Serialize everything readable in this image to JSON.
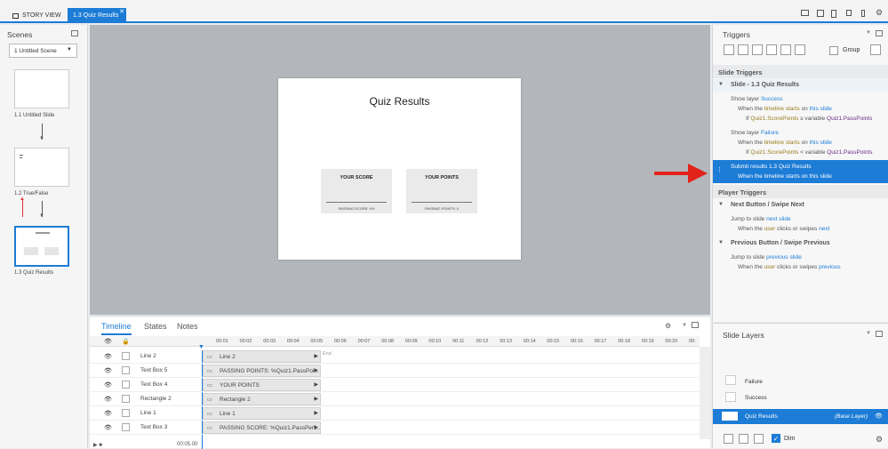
{
  "tabs": {
    "story_view": "STORY VIEW",
    "quiz_results": "1.3 Quiz Results"
  },
  "scenes": {
    "title": "Scenes",
    "dropdown": "1 Untitled Scene",
    "slides": [
      {
        "label": "1.1 Untitled Slide"
      },
      {
        "label": "1.2 True/False"
      },
      {
        "label": "1.3 Quiz Results"
      }
    ]
  },
  "slide": {
    "title": "Quiz Results",
    "score_label": "YOUR SCORE",
    "points_label": "YOUR POINTS",
    "passing_score": "PASSING SCORE: 0%",
    "passing_points": "PASSING POINTS: 0"
  },
  "timeline": {
    "tabs": [
      "Timeline",
      "States",
      "Notes"
    ],
    "ticks": [
      "00:01",
      "00:02",
      "00:03",
      "00:04",
      "00:05",
      "00:06",
      "00:07",
      "00:08",
      "00:09",
      "00:10",
      "00:11",
      "00:12",
      "00:13",
      "00:14",
      "00:15",
      "00:16",
      "00:17",
      "00:18",
      "00:19",
      "00:20",
      "00:"
    ],
    "end_label": "End",
    "time_readout": "00:05.00",
    "rows": [
      {
        "name": "Line 2",
        "bar": "Line 2"
      },
      {
        "name": "Text Box 5",
        "bar": "PASSING POINTS: %Quiz1.PassPoi..."
      },
      {
        "name": "Text Box 4",
        "bar": "YOUR POINTS"
      },
      {
        "name": "Rectangle 2",
        "bar": "Rectangle 2"
      },
      {
        "name": "Line 1",
        "bar": "Line 1"
      },
      {
        "name": "Text Box 3",
        "bar": "PASSING SCORE: %Quiz1.PassPerc..."
      }
    ]
  },
  "triggers": {
    "title": "Triggers",
    "group_label": "Group",
    "slide_triggers": "Slide Triggers",
    "slide_name": "Slide - 1.3 Quiz Results",
    "t1": {
      "l1a": "Show layer ",
      "l1b": "Success",
      "l2a": "When the ",
      "l2b": "timeline starts",
      "l2c": " on ",
      "l2d": "this slide",
      "l3a": "If ",
      "l3b": "Quiz1.ScorePoints",
      "l3c": " ≥ variable ",
      "l3d": "Quiz1.PassPoints"
    },
    "t2": {
      "l1a": "Show layer ",
      "l1b": "Failure",
      "l2a": "When the ",
      "l2b": "timeline starts",
      "l2c": " on ",
      "l2d": "this slide",
      "l3a": "If ",
      "l3b": "Quiz1.ScorePoints",
      "l3c": " < variable ",
      "l3d": "Quiz1.PassPoints"
    },
    "t3": {
      "l1": "Submit results 1.3 Quiz Results",
      "l2": "When the timeline starts on this slide"
    },
    "player_triggers": "Player Triggers",
    "next_head": "Next Button / Swipe Next",
    "next": {
      "l1a": "Jump to slide ",
      "l1b": "next slide",
      "l2a": "When the ",
      "l2b": "user",
      "l2c": " clicks or swipes ",
      "l2d": "next"
    },
    "prev_head": "Previous Button / Swipe Previous",
    "prev": {
      "l1a": "Jump to slide ",
      "l1b": "previous slide",
      "l2a": "When the ",
      "l2b": "user",
      "l2c": " clicks or swipes ",
      "l2d": "previous"
    }
  },
  "layers": {
    "title": "Slide Layers",
    "items": [
      "Failure",
      "Success"
    ],
    "base_name": "Quiz Results",
    "base_tag": "(Base Layer)",
    "dim": "Dim"
  },
  "colors": {
    "accent": "#1c7cd6",
    "arrow": "#e2231a"
  }
}
